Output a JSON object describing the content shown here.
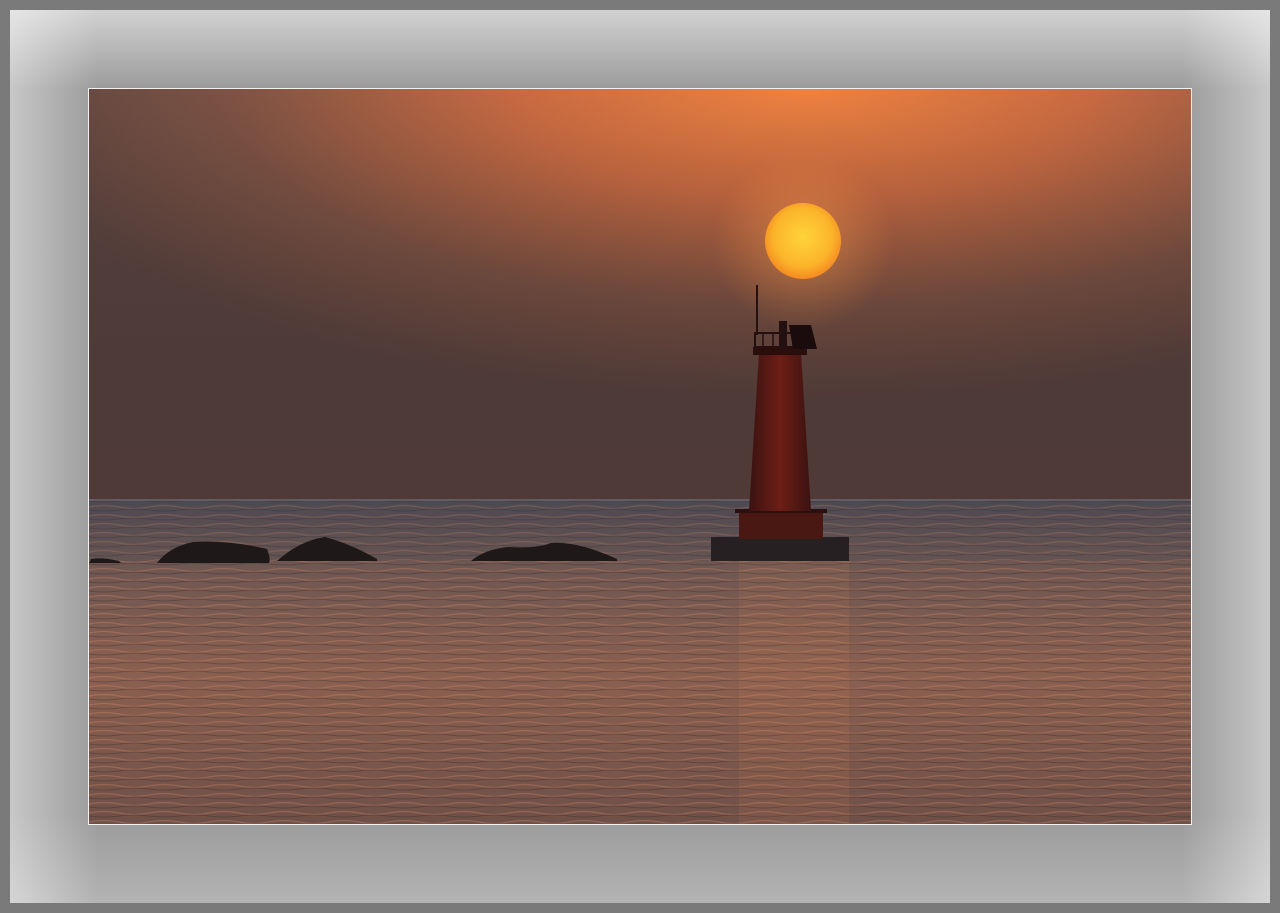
{
  "image": {
    "subject": "lighthouse-at-sunset",
    "colors": {
      "sky_top": "#e07a3c",
      "sky_mid": "#8a5640",
      "sky_low": "#5e4540",
      "sun": "#fbb52a",
      "sea": "#5a4a48",
      "sea_glow": "#b8684a",
      "frame": "#9a9a9a",
      "lighthouse": "#5a1a14"
    }
  }
}
